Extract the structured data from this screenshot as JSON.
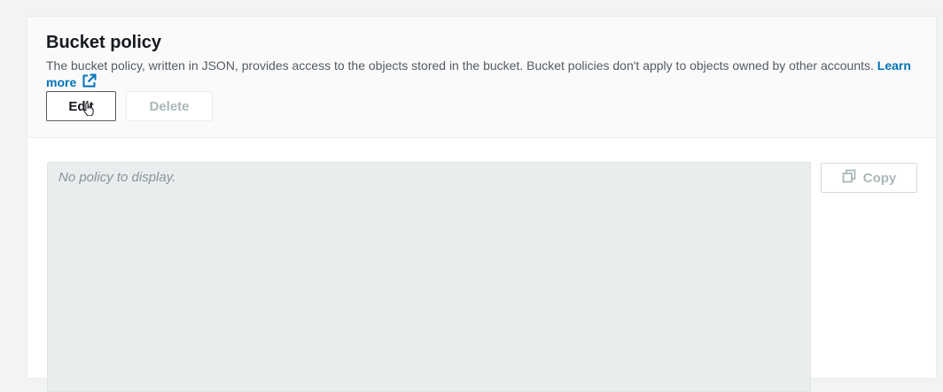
{
  "section": {
    "title": "Bucket policy",
    "description": "The bucket policy, written in JSON, provides access to the objects stored in the bucket. Bucket policies don't apply to objects owned by other accounts.",
    "learn_more_label": "Learn more"
  },
  "actions": {
    "edit_label": "Edit",
    "delete_label": "Delete",
    "copy_label": "Copy"
  },
  "policy": {
    "empty_text": "No policy to display."
  },
  "icons": {
    "external_link": "external-link-icon",
    "copy": "copy-icon",
    "cursor": "hand-pointer-icon"
  },
  "colors": {
    "link": "#0073bb",
    "disabled_text": "#aab7b8",
    "policy_background": "#eaeded"
  }
}
